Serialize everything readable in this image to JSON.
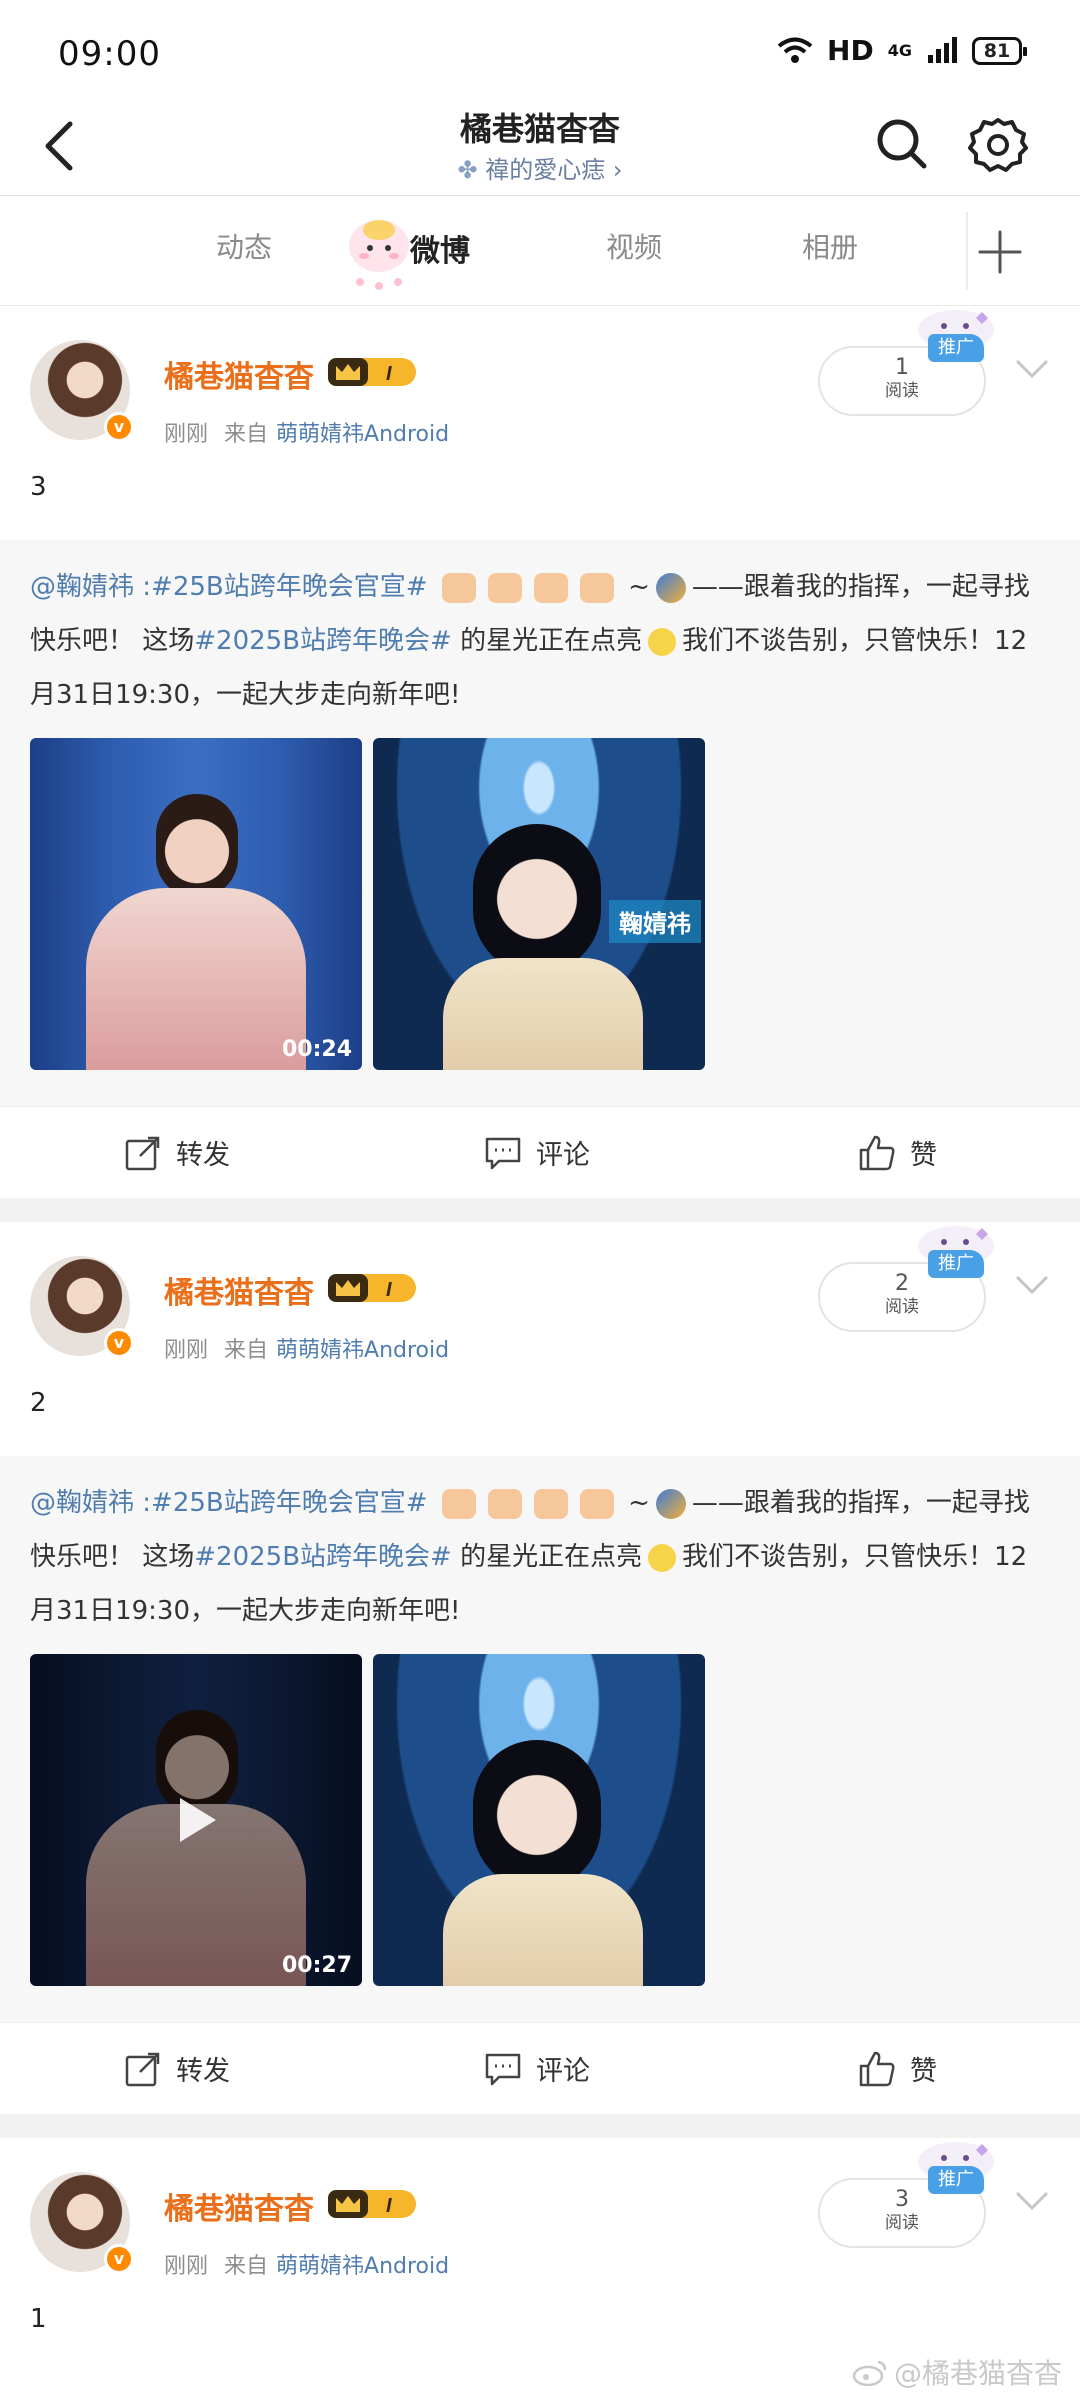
{
  "status_bar": {
    "time": "09:00",
    "network": "HD",
    "signal_label": "4G",
    "battery": "81"
  },
  "nav": {
    "title": "橘巷猫杳杳",
    "subtitle": "禕的愛心痣 ›"
  },
  "tabs": [
    {
      "label": "动态",
      "active": false
    },
    {
      "label": "微博",
      "active": true
    },
    {
      "label": "视频",
      "active": false
    },
    {
      "label": "相册",
      "active": false
    }
  ],
  "posts": [
    {
      "author": "橘巷猫杳杳",
      "time": "刚刚",
      "from_label": "来自",
      "source": "萌萌婧祎Android",
      "reads": "1",
      "reads_label": "阅读",
      "promo_label": "推广",
      "text": "3",
      "repost": {
        "mention": "@鞠婧祎",
        "hashtag1": ":#25B站跨年晚会官宣#",
        "part1": "~",
        "part2": "——跟着我的指挥，一起寻找快乐吧！ 这场",
        "hashtag2": "#2025B站跨年晚会#",
        "part3": "的星光正在点亮",
        "part4": "我们不谈告别，只管快乐！12月31日19:30，一起大步走向新年吧!",
        "media": [
          {
            "type": "video",
            "duration": "00:24"
          },
          {
            "type": "image",
            "tag": "鞠婧祎"
          }
        ]
      },
      "actions": {
        "repost": "转发",
        "comment": "评论",
        "like": "赞"
      }
    },
    {
      "author": "橘巷猫杳杳",
      "time": "刚刚",
      "from_label": "来自",
      "source": "萌萌婧祎Android",
      "reads": "2",
      "reads_label": "阅读",
      "promo_label": "推广",
      "text": "2",
      "repost": {
        "mention": "@鞠婧祎",
        "hashtag1": ":#25B站跨年晚会官宣#",
        "part1": "~",
        "part2": "——跟着我的指挥，一起寻找快乐吧！ 这场",
        "hashtag2": "#2025B站跨年晚会#",
        "part3": "的星光正在点亮",
        "part4": "我们不谈告别，只管快乐！12月31日19:30，一起大步走向新年吧!",
        "media": [
          {
            "type": "video",
            "duration": "00:27"
          },
          {
            "type": "image"
          }
        ]
      },
      "actions": {
        "repost": "转发",
        "comment": "评论",
        "like": "赞"
      }
    },
    {
      "author": "橘巷猫杳杳",
      "time": "刚刚",
      "from_label": "来自",
      "source": "萌萌婧祎Android",
      "reads": "3",
      "reads_label": "阅读",
      "promo_label": "推广",
      "text": "1"
    }
  ],
  "watermark": "@橘巷猫杳杳",
  "colors": {
    "author": "#ea6f1a",
    "link": "#507daf",
    "promo": "#4aa0e6",
    "badge": "#ff8a00"
  },
  "icons": [
    "back-icon",
    "search-icon",
    "gear-icon",
    "plus-icon",
    "chevron-down-icon",
    "repost-icon",
    "comment-icon",
    "like-icon",
    "play-icon",
    "crown-badge-icon"
  ]
}
